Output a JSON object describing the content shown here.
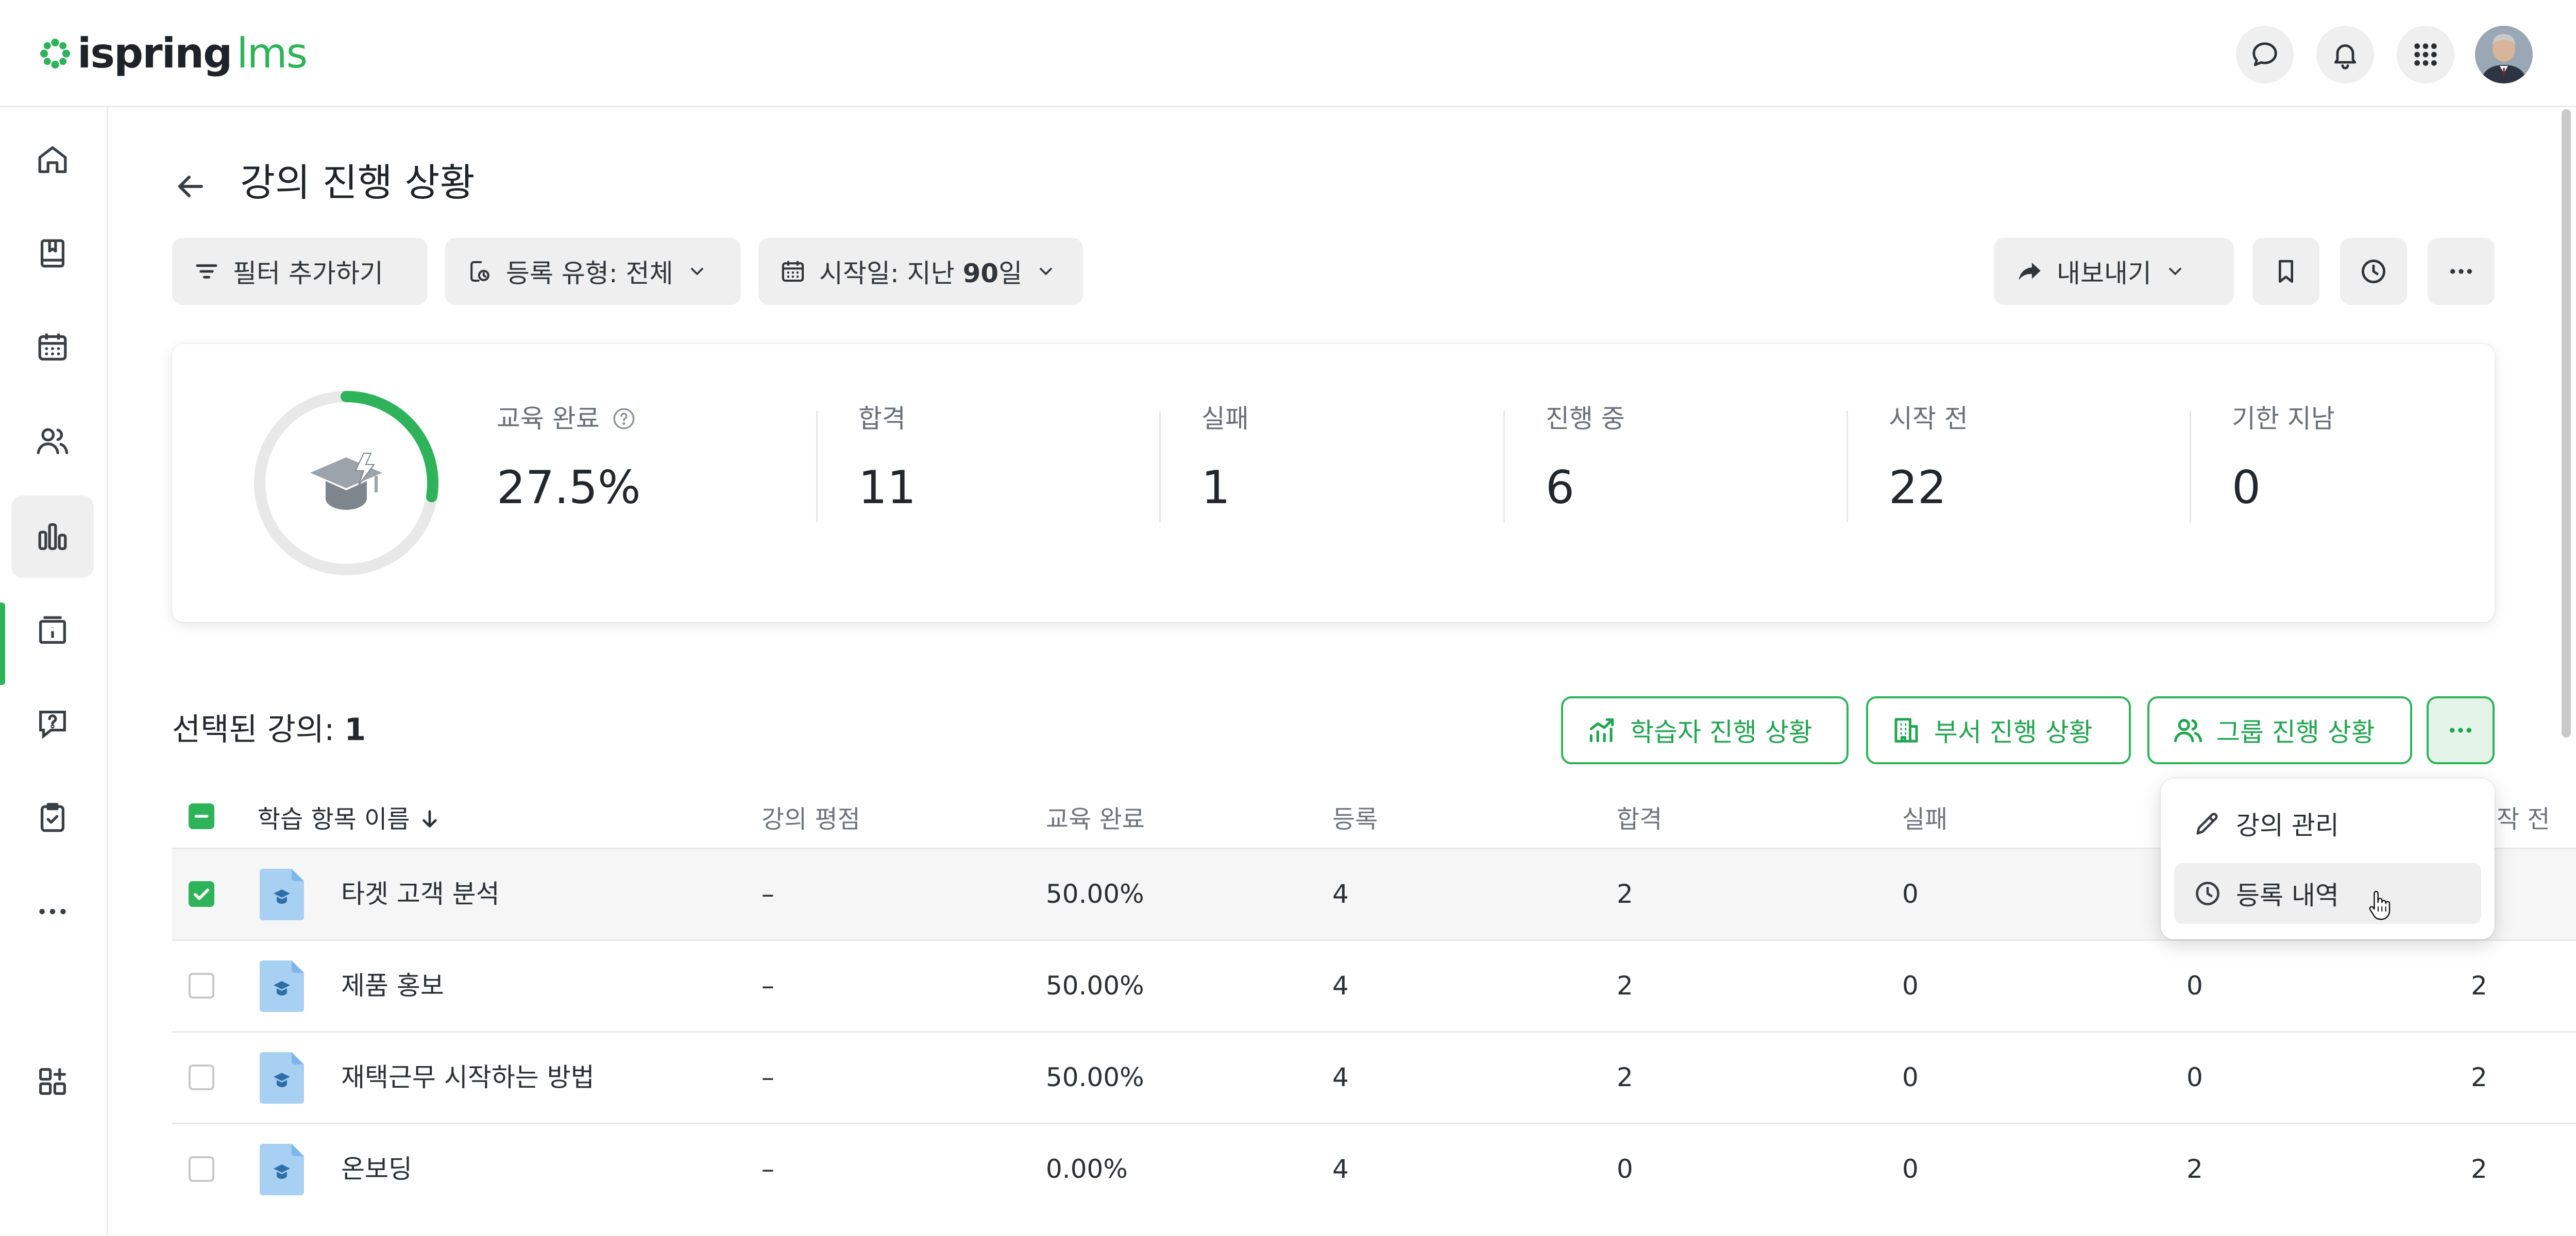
{
  "app": {
    "logo_primary": "ispring",
    "logo_secondary": "lms",
    "brand_color": "#2eb35a"
  },
  "topbar": {
    "icons": [
      "chat-icon",
      "bell-icon",
      "apps-grid-icon"
    ],
    "avatar": "user-avatar"
  },
  "sidebar": {
    "items": [
      {
        "icon": "home-icon"
      },
      {
        "icon": "book-icon"
      },
      {
        "icon": "calendar-icon"
      },
      {
        "icon": "users-icon"
      },
      {
        "icon": "bar-chart-icon",
        "active": true
      },
      {
        "icon": "info-board-icon"
      },
      {
        "icon": "question-bubble-icon"
      },
      {
        "icon": "clipboard-check-icon"
      },
      {
        "icon": "more-dots-icon"
      },
      {
        "icon": "add-widget-icon"
      }
    ]
  },
  "header": {
    "title": "강의 진행 상황",
    "filters": {
      "add_filter": "필터 추가하기",
      "enrollment_type_label": "등록 유형: 전체",
      "start_date_prefix": "시작일: 지난 ",
      "start_date_value": "90",
      "start_date_suffix": "일"
    },
    "export_label": "내보내기"
  },
  "stats": {
    "completion_label": "교육 완료",
    "completion_value": "27.5%",
    "completion_fraction": 0.275,
    "passed_label": "합격",
    "passed_value": "11",
    "failed_label": "실패",
    "failed_value": "1",
    "in_progress_label": "진행 중",
    "in_progress_value": "6",
    "not_started_label": "시작 전",
    "not_started_value": "22",
    "overdue_label": "기한 지남",
    "overdue_value": "0"
  },
  "selection": {
    "label": "선택된 강의: ",
    "count": "1",
    "learner_progress": "학습자 진행 상황",
    "department_progress": "부서 진행 상황",
    "group_progress": "그룹 진행 상황"
  },
  "table": {
    "columns": {
      "name": "학습 항목 이름",
      "rating": "강의 평점",
      "completion": "교육 완료",
      "enrolled": "등록",
      "passed": "합격",
      "failed": "실패",
      "not_started_partial": "작 전"
    },
    "rows": [
      {
        "name": "타겟 고객 분석",
        "rating": "–",
        "completion": "50.00%",
        "enrolled": "4",
        "passed": "2",
        "failed": "0",
        "in_progress": "",
        "not_started": "",
        "checked": true
      },
      {
        "name": "제품 홍보",
        "rating": "–",
        "completion": "50.00%",
        "enrolled": "4",
        "passed": "2",
        "failed": "0",
        "in_progress": "0",
        "not_started": "2",
        "checked": false
      },
      {
        "name": "재택근무 시작하는 방법",
        "rating": "–",
        "completion": "50.00%",
        "enrolled": "4",
        "passed": "2",
        "failed": "0",
        "in_progress": "0",
        "not_started": "2",
        "checked": false
      },
      {
        "name": "온보딩",
        "rating": "–",
        "completion": "0.00%",
        "enrolled": "4",
        "passed": "0",
        "failed": "0",
        "in_progress": "2",
        "not_started": "2",
        "checked": false
      }
    ]
  },
  "menu": {
    "manage_course": "강의 관리",
    "enrollment_history": "등록 내역"
  }
}
